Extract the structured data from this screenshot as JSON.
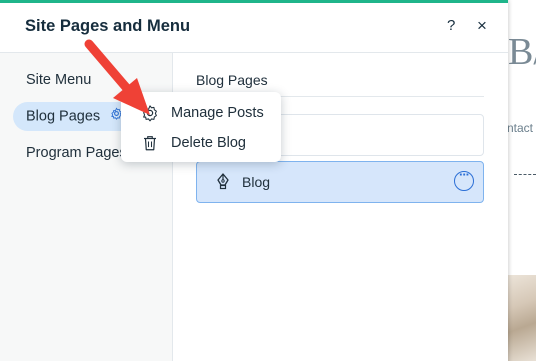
{
  "panel": {
    "title": "Site Pages and Menu",
    "help_label": "?",
    "close_label": "×"
  },
  "sidebar": {
    "items": [
      {
        "label": "Site Menu"
      },
      {
        "label": "Blog Pages"
      },
      {
        "label": "Program Pages"
      }
    ]
  },
  "main": {
    "section_title": "Blog Pages",
    "blog_item_label": "Blog",
    "more_label": "···"
  },
  "dropdown": {
    "items": [
      {
        "label": "Manage Posts",
        "icon": "gear-icon"
      },
      {
        "label": "Delete Blog",
        "icon": "trash-icon"
      }
    ]
  },
  "background_site": {
    "heading_fragment": "B/",
    "link_fragment": "ntact"
  },
  "colors": {
    "accent": "#1fb58a",
    "selection": "#d6e6fb",
    "selection_border": "#7fb3ee",
    "link_blue": "#2b6fd6",
    "annotation_arrow": "#ef4136"
  }
}
